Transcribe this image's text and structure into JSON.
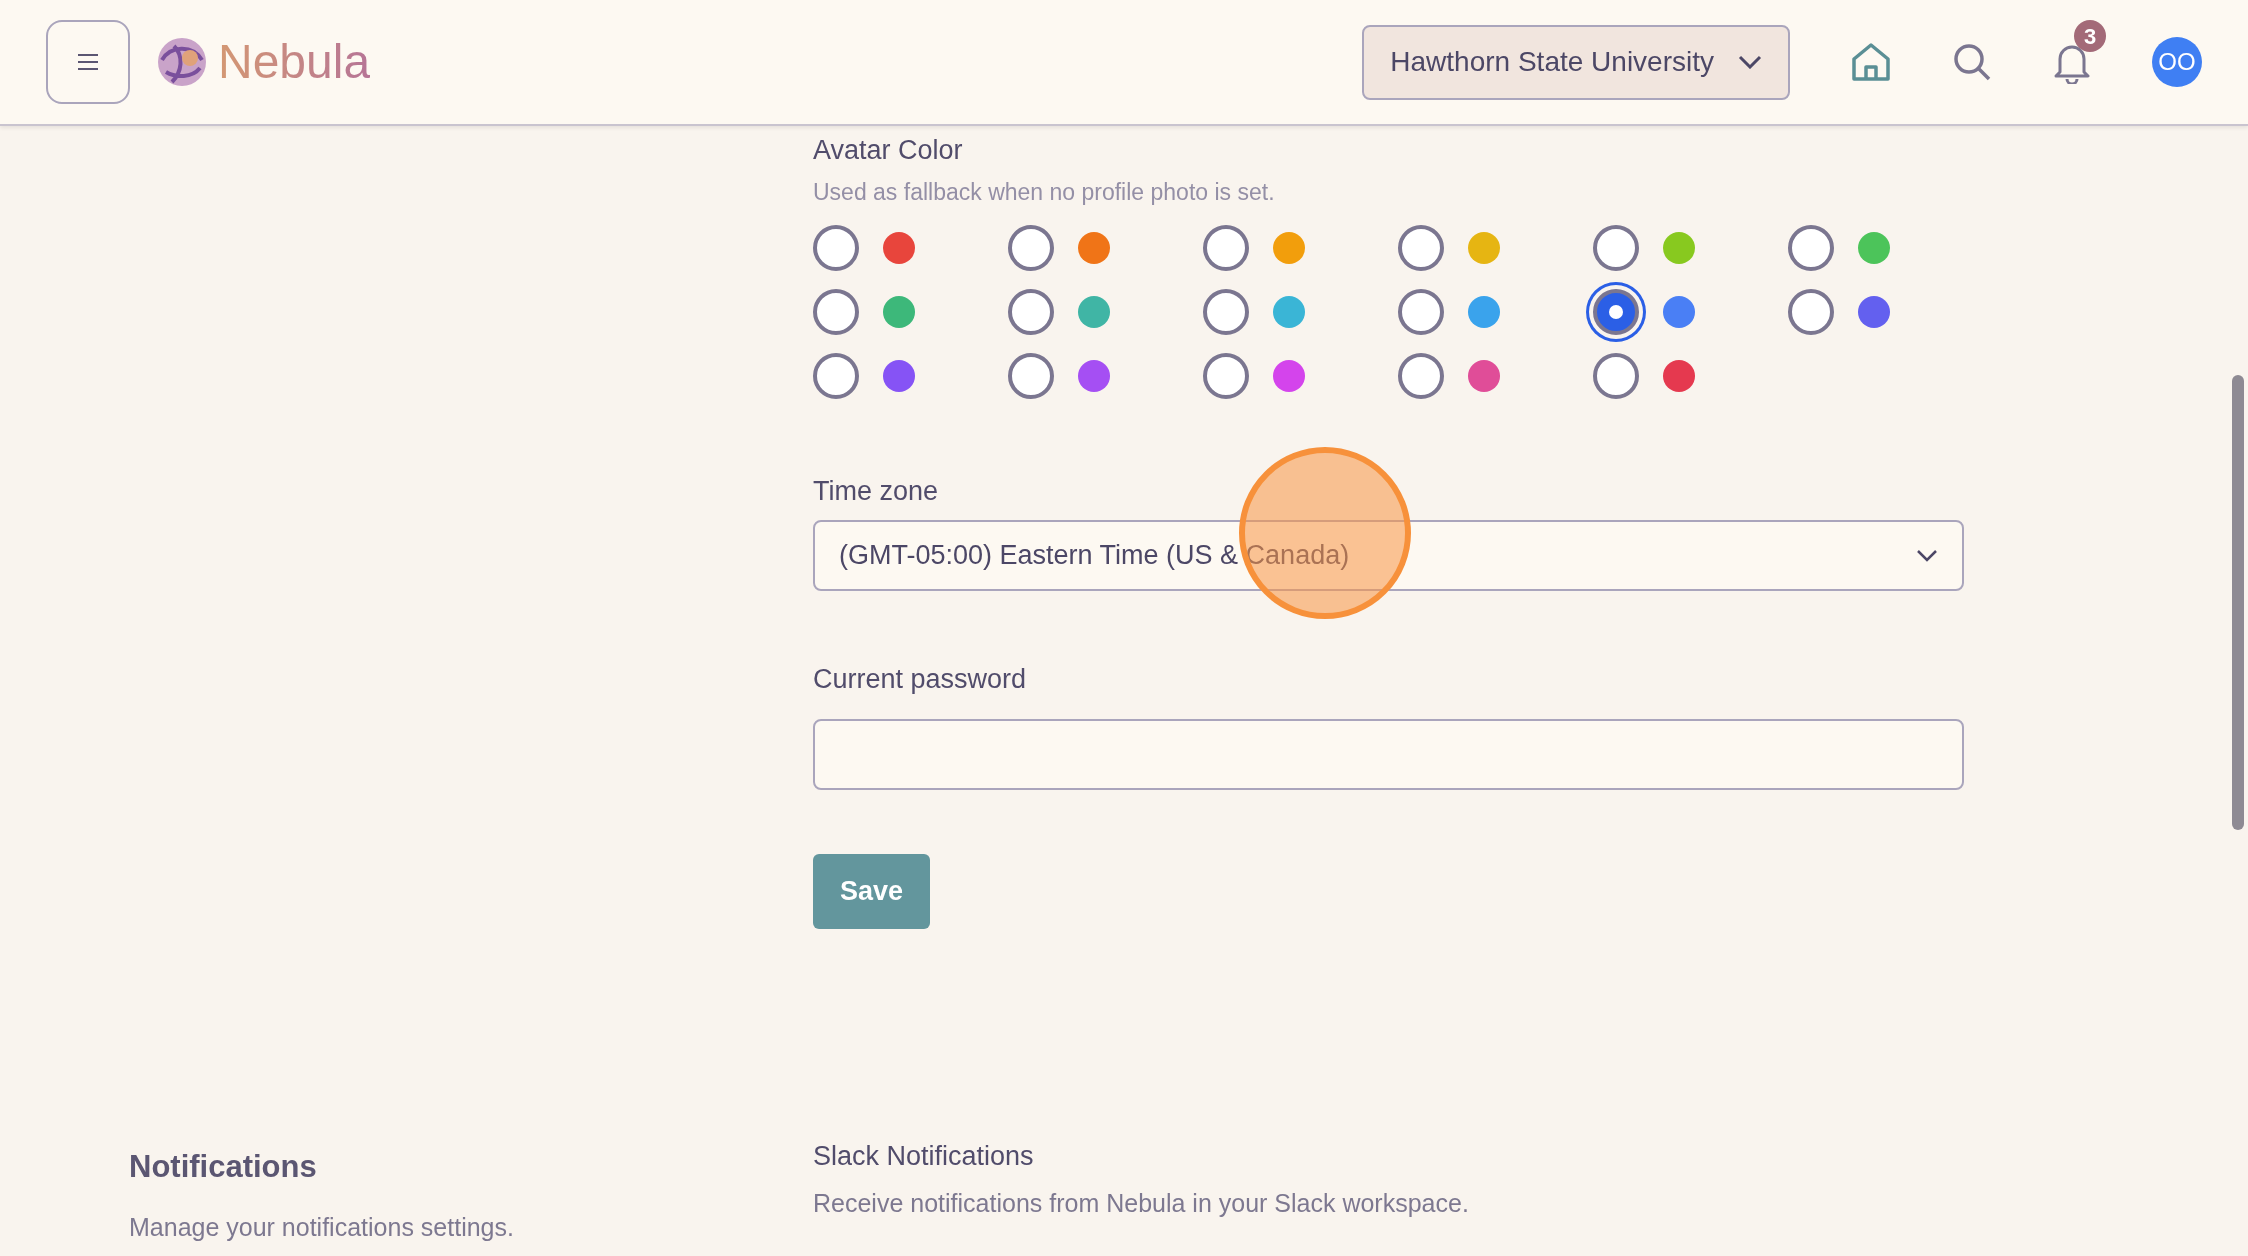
{
  "header": {
    "logo_text": "Nebula",
    "organization": "Hawthorn State University",
    "notification_count": "3",
    "avatar_initials": "OO"
  },
  "avatar_color": {
    "label": "Avatar Color",
    "help": "Used as fallback when no profile photo is set.",
    "options": [
      {
        "color": "#e8453c",
        "selected": false
      },
      {
        "color": "#f07417",
        "selected": false
      },
      {
        "color": "#f29e0c",
        "selected": false
      },
      {
        "color": "#e6b512",
        "selected": false
      },
      {
        "color": "#88c91f",
        "selected": false
      },
      {
        "color": "#4cc45a",
        "selected": false
      },
      {
        "color": "#3db87a",
        "selected": false
      },
      {
        "color": "#40b5a5",
        "selected": false
      },
      {
        "color": "#3ab5d6",
        "selected": false
      },
      {
        "color": "#3aa3ec",
        "selected": false
      },
      {
        "color": "#4a7ff5",
        "selected": true
      },
      {
        "color": "#6360ef",
        "selected": false
      },
      {
        "color": "#8653f5",
        "selected": false
      },
      {
        "color": "#a54ff3",
        "selected": false
      },
      {
        "color": "#d444ec",
        "selected": false
      },
      {
        "color": "#e04d98",
        "selected": false
      },
      {
        "color": "#e5394f",
        "selected": false
      }
    ]
  },
  "time_zone": {
    "label": "Time zone",
    "value": "(GMT-05:00) Eastern Time (US & Canada)"
  },
  "current_password": {
    "label": "Current password"
  },
  "save_button": "Save",
  "notifications": {
    "title": "Notifications",
    "description": "Manage your notifications settings.",
    "slack": {
      "title": "Slack Notifications",
      "description": "Receive notifications from Nebula in your Slack workspace."
    }
  }
}
